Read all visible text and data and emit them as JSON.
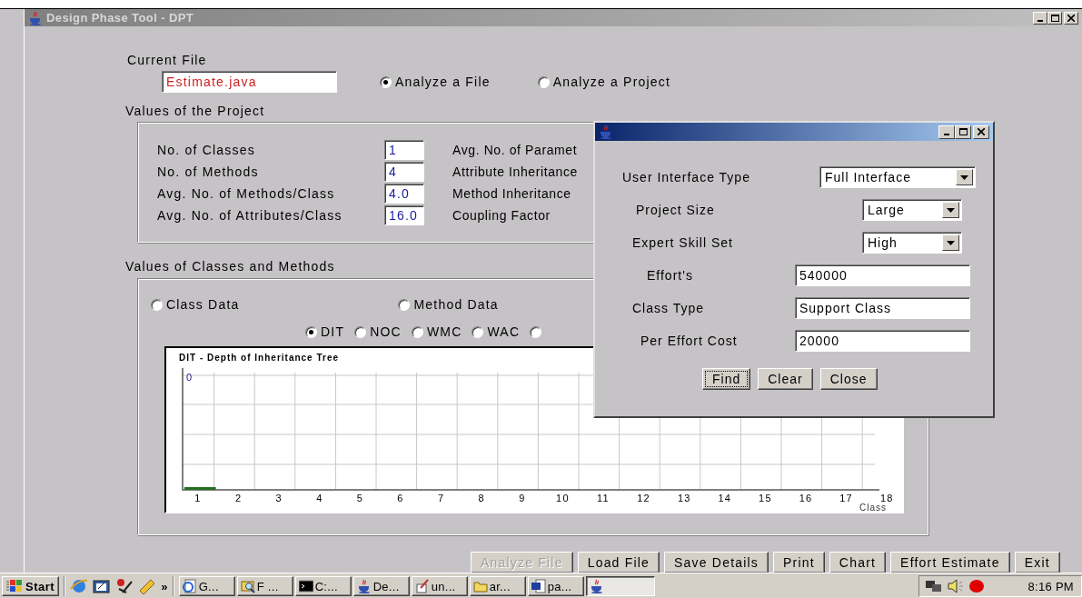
{
  "window": {
    "title": "Design Phase Tool - DPT"
  },
  "current_file": {
    "label": "Current File",
    "value": "Estimate.java"
  },
  "mode_options": [
    {
      "label": "Analyze a File",
      "selected": true
    },
    {
      "label": "Analyze a Project",
      "selected": false
    }
  ],
  "project_values": {
    "title": "Values of the Project",
    "rows": [
      {
        "label": "No. of Classes",
        "value": "1",
        "right_label": "Avg. No. of Paramet"
      },
      {
        "label": "No. of Methods",
        "value": "4",
        "right_label": "Attribute Inheritance"
      },
      {
        "label": "Avg. No. of Methods/Class",
        "value": "4.0",
        "right_label": "Method Inheritance"
      },
      {
        "label": "Avg. No. of Attributes/Class",
        "value": "16.0",
        "right_label": "Coupling Factor"
      }
    ]
  },
  "classes_methods": {
    "title": "Values of Classes and Methods",
    "data_options": [
      {
        "label": "Class Data",
        "selected": false
      },
      {
        "label": "Method Data",
        "selected": false
      }
    ],
    "metric_options": [
      {
        "label": "DIT",
        "selected": true
      },
      {
        "label": "NOC",
        "selected": false
      },
      {
        "label": "WMC",
        "selected": false
      },
      {
        "label": "WAC",
        "selected": false
      },
      {
        "selected": false
      }
    ],
    "chart": {
      "title": "DIT - Depth of Inheritance Tree",
      "top_label": "0",
      "axis_title": "Class",
      "x_labels": [
        "1",
        "2",
        "3",
        "4",
        "5",
        "6",
        "7",
        "8",
        "9",
        "10",
        "11",
        "12",
        "13",
        "14",
        "15",
        "16",
        "17",
        "18"
      ]
    }
  },
  "buttons": [
    {
      "label": "Analyze File",
      "disabled": true
    },
    {
      "label": "Load File",
      "disabled": false
    },
    {
      "label": "Save Details",
      "disabled": false
    },
    {
      "label": "Print",
      "disabled": false
    },
    {
      "label": "Chart",
      "disabled": false
    },
    {
      "label": "Effort Estimate",
      "disabled": false
    },
    {
      "label": "Exit",
      "disabled": false
    }
  ],
  "dialog": {
    "fields": [
      {
        "kind": "dropdown",
        "label": "User Interface Type",
        "value": "Full Interface"
      },
      {
        "kind": "dropdown",
        "label": "Project Size",
        "value": "Large"
      },
      {
        "kind": "dropdown",
        "label": "Expert Skill Set",
        "value": "High"
      },
      {
        "kind": "text",
        "label": "Effort's",
        "value": "540000"
      },
      {
        "kind": "text",
        "label": "Class Type",
        "value": "Support Class"
      },
      {
        "kind": "text",
        "label": "Per Effort Cost",
        "value": "20000"
      }
    ],
    "buttons": [
      {
        "label": "Find",
        "focused": true
      },
      {
        "label": "Clear",
        "focused": false
      },
      {
        "label": "Close",
        "focused": false
      }
    ]
  },
  "taskbar": {
    "start": "Start",
    "more": "»",
    "tasks": [
      {
        "label": "G...",
        "active": false
      },
      {
        "label": "F ...",
        "active": false
      },
      {
        "label": "C:...",
        "active": false
      },
      {
        "label": "De...",
        "active": false
      },
      {
        "label": "un...",
        "active": false
      },
      {
        "label": "ar...",
        "active": false
      },
      {
        "label": "pa...",
        "active": false
      },
      {
        "active": true
      }
    ],
    "clock": "8:16 PM"
  }
}
